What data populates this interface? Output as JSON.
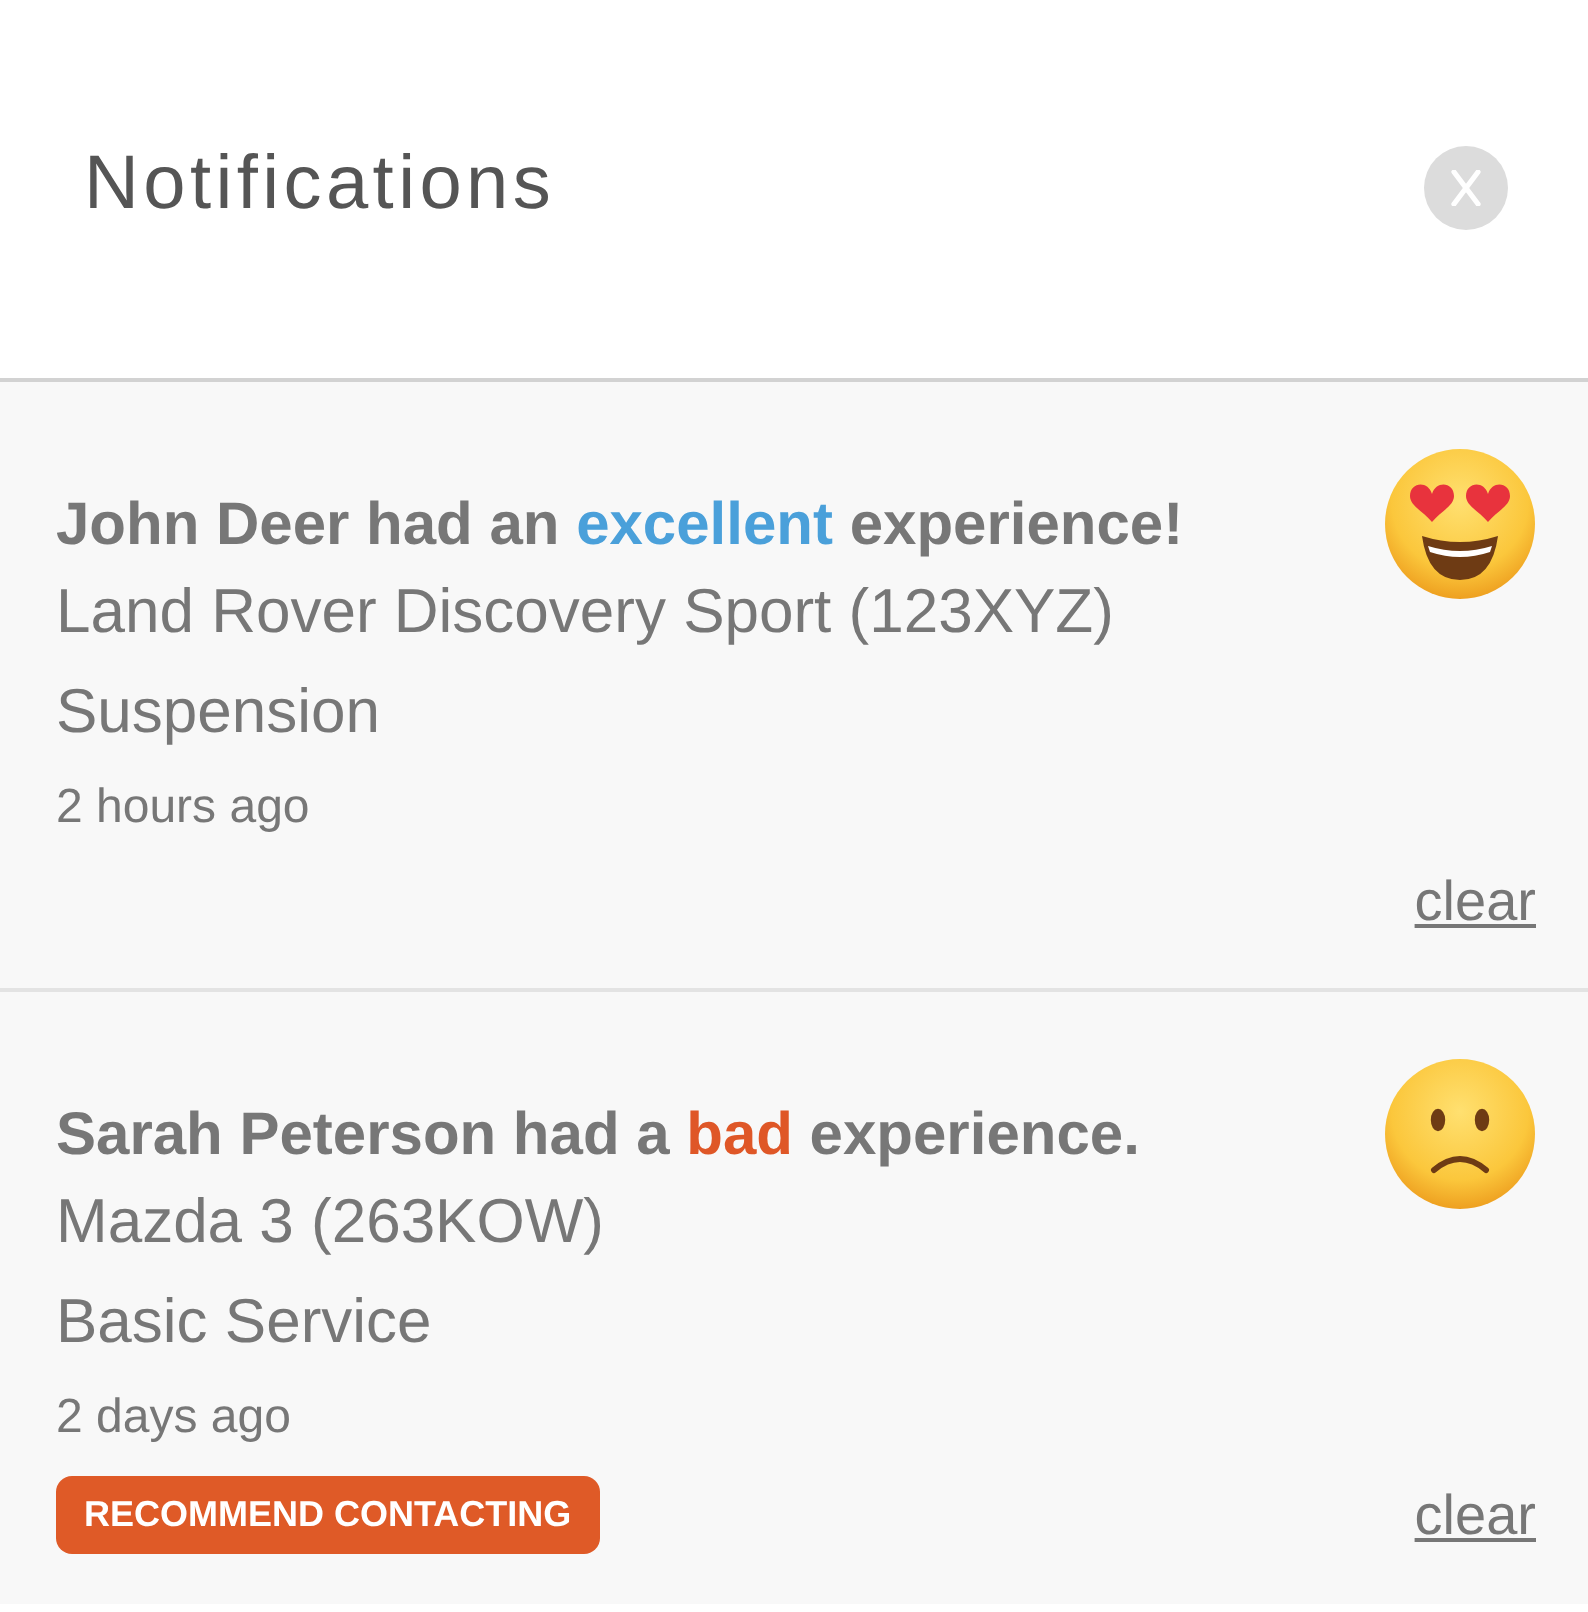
{
  "header": {
    "title": "Notifications"
  },
  "notifications": [
    {
      "kind": "excellent",
      "headline_start": "John Deer had an",
      "rating": "excellent",
      "headline_end": "experience!",
      "vehicle": "Land Rover Discovery Sport (123XYZ)",
      "service": "Suspension",
      "time": "2 hours ago",
      "action": "clear"
    },
    {
      "kind": "bad",
      "headline_start": "Sarah Peterson had a",
      "rating": "bad",
      "headline_end": "experience.",
      "vehicle": "Mazda 3 (263KOW)",
      "service": "Basic Service",
      "time": "2 days ago",
      "tag": "RECOMMEND CONTACTING",
      "action": "clear"
    }
  ]
}
